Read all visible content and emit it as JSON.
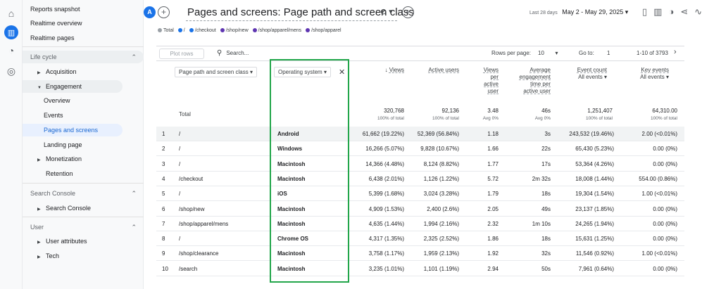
{
  "rail_icons": [
    "home-icon",
    "reports-icon",
    "explore-icon",
    "advertising-icon"
  ],
  "sidebar": {
    "top_items": [
      "Reports snapshot",
      "Realtime overview",
      "Realtime pages"
    ],
    "lifecycle": {
      "title": "Life cycle",
      "acquisition": "Acquisition",
      "engagement": "Engagement",
      "engagement_children": [
        "Overview",
        "Events",
        "Pages and screens",
        "Landing page"
      ],
      "monetization": "Monetization",
      "retention": "Retention"
    },
    "search_console": {
      "title": "Search Console",
      "item": "Search Console"
    },
    "user": {
      "title": "User",
      "attributes": "User attributes",
      "tech": "Tech"
    }
  },
  "header": {
    "avatar_letter": "A",
    "title": "Pages and screens: Page path and screen class",
    "date_label": "Last 28 days",
    "date_range": "May 2 - May 29, 2025"
  },
  "legend": [
    "Total",
    "/",
    "/checkout",
    "/shop/new",
    "/shop/apparel/mens",
    "/shop/apparel"
  ],
  "legend_colors": [
    "#9aa0a6",
    "#1a73e8",
    "#1a73e8",
    "#5e35b1",
    "#5e35b1",
    "#5e35b1"
  ],
  "toolbar": {
    "plot_rows": "Plot rows",
    "search_placeholder": "Search...",
    "rows_per_page_label": "Rows per page:",
    "rows_per_page_value": "10",
    "goto_label": "Go to:",
    "goto_value": "1",
    "pager": "1-10 of 3793"
  },
  "dims": {
    "primary": "Page path and screen class",
    "secondary": "Operating system"
  },
  "columns": {
    "views": "Views",
    "active_users": "Active users",
    "views_per_user": [
      "Views",
      "per",
      "active",
      "user"
    ],
    "avg_engagement": [
      "Average",
      "engagement",
      "time per",
      "active user"
    ],
    "event_count": "Event count",
    "event_count_sub": "All events",
    "key_events": "Key events",
    "key_events_sub": "All events"
  },
  "totals": {
    "label": "Total",
    "views": "320,768",
    "views_sub": "100% of total",
    "active_users": "92,136",
    "active_users_sub": "100% of total",
    "vpu": "3.48",
    "vpu_sub": "Avg 0%",
    "avg_time": "46s",
    "avg_time_sub": "Avg 0%",
    "events": "1,251,407",
    "events_sub": "100% of total",
    "key_events": "64,310.00",
    "key_events_sub": "100% of total"
  },
  "rows": [
    {
      "n": "1",
      "path": "/",
      "os": "Android",
      "views": "61,662 (19.22%)",
      "users": "52,369 (56.84%)",
      "vpu": "1.18",
      "time": "3s",
      "events": "243,532 (19.46%)",
      "key": "2.00 (<0.01%)"
    },
    {
      "n": "2",
      "path": "/",
      "os": "Windows",
      "views": "16,266 (5.07%)",
      "users": "9,828 (10.67%)",
      "vpu": "1.66",
      "time": "22s",
      "events": "65,430 (5.23%)",
      "key": "0.00 (0%)"
    },
    {
      "n": "3",
      "path": "/",
      "os": "Macintosh",
      "views": "14,366 (4.48%)",
      "users": "8,124 (8.82%)",
      "vpu": "1.77",
      "time": "17s",
      "events": "53,364 (4.26%)",
      "key": "0.00 (0%)"
    },
    {
      "n": "4",
      "path": "/checkout",
      "os": "Macintosh",
      "views": "6,438 (2.01%)",
      "users": "1,126 (1.22%)",
      "vpu": "5.72",
      "time": "2m 32s",
      "events": "18,008 (1.44%)",
      "key": "554.00 (0.86%)"
    },
    {
      "n": "5",
      "path": "/",
      "os": "iOS",
      "views": "5,399 (1.68%)",
      "users": "3,024 (3.28%)",
      "vpu": "1.79",
      "time": "18s",
      "events": "19,304 (1.54%)",
      "key": "1.00 (<0.01%)"
    },
    {
      "n": "6",
      "path": "/shop/new",
      "os": "Macintosh",
      "views": "4,909 (1.53%)",
      "users": "2,400 (2.6%)",
      "vpu": "2.05",
      "time": "49s",
      "events": "23,137 (1.85%)",
      "key": "0.00 (0%)"
    },
    {
      "n": "7",
      "path": "/shop/apparel/mens",
      "os": "Macintosh",
      "views": "4,635 (1.44%)",
      "users": "1,994 (2.16%)",
      "vpu": "2.32",
      "time": "1m 10s",
      "events": "24,265 (1.94%)",
      "key": "0.00 (0%)"
    },
    {
      "n": "8",
      "path": "/",
      "os": "Chrome OS",
      "views": "4,317 (1.35%)",
      "users": "2,325 (2.52%)",
      "vpu": "1.86",
      "time": "18s",
      "events": "15,631 (1.25%)",
      "key": "0.00 (0%)"
    },
    {
      "n": "9",
      "path": "/shop/clearance",
      "os": "Macintosh",
      "views": "3,758 (1.17%)",
      "users": "1,959 (2.13%)",
      "vpu": "1.92",
      "time": "32s",
      "events": "11,546 (0.92%)",
      "key": "1.00 (<0.01%)"
    },
    {
      "n": "10",
      "path": "/search",
      "os": "Macintosh",
      "views": "3,235 (1.01%)",
      "users": "1,101 (1.19%)",
      "vpu": "2.94",
      "time": "50s",
      "events": "7,961 (0.64%)",
      "key": "0.00 (0%)"
    }
  ]
}
